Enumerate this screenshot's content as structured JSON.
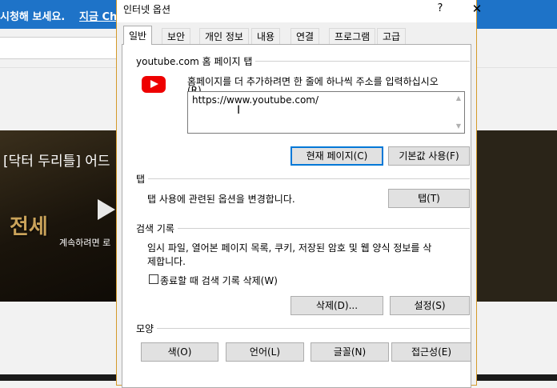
{
  "background": {
    "banner_text": "시청해 보세요.",
    "banner_link": "지금 Ch",
    "video_title": "[닥터 두리틀] 어드",
    "video_big_text": "전세",
    "video_continue_text": "계속하려면 로"
  },
  "dialog": {
    "title": "인터넷 옵션",
    "help_symbol": "?",
    "close_symbol": "✕",
    "tabs": [
      "일반",
      "보안",
      "개인 정보",
      "내용",
      "연결",
      "프로그램",
      "고급"
    ],
    "home": {
      "group_label": "youtube.com 홈 페이지 탭",
      "instruction": "홈페이지를 더 추가하려면 한 줄에 하나씩 주소를 입력하십시오",
      "instruction_cut": "(R).",
      "url_value": "https://www.youtube.com/",
      "current_page_button": "현재 페이지(C)",
      "default_button": "기본값 사용(F)"
    },
    "tabs_section": {
      "group_label": "탭",
      "description": "탭 사용에 관련된 옵션을 변경합니다.",
      "button": "탭(T)"
    },
    "history": {
      "group_label": "검색 기록",
      "description_line1": "임시 파일, 열어본 페이지 목록, 쿠키, 저장된 암호 및 웹 양식 정보를 삭",
      "description_line2": "제합니다.",
      "checkbox_label": "종료할 때 검색 기록 삭제(W)",
      "checkbox_checked": false,
      "delete_button": "삭제(D)...",
      "settings_button": "설정(S)"
    },
    "appearance": {
      "group_label": "모양",
      "buttons": [
        "색(O)",
        "언어(L)",
        "글꼴(N)",
        "접근성(E)"
      ]
    }
  },
  "colors": {
    "banner": "#1e73c8",
    "dialog_border": "#d49a2a",
    "default_button_border": "#0078d7",
    "youtube_red": "#ee0000"
  }
}
